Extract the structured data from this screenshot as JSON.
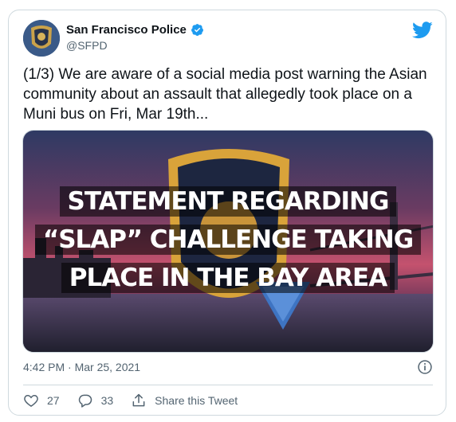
{
  "author": {
    "name": "San Francisco Police",
    "handle": "@SFPD"
  },
  "tweet": {
    "text": "(1/3) We are aware of a social media post warning the Asian community about an assault that allegedly took place on a Muni bus on Fri, Mar 19th...",
    "timestamp": "4:42 PM · Mar 25, 2021"
  },
  "media": {
    "headline_lines": [
      "STATEMENT REGARDING",
      "“SLAP” CHALLENGE TAKING",
      "PLACE IN THE BAY AREA"
    ]
  },
  "actions": {
    "likes": "27",
    "replies": "33",
    "share_label": "Share this Tweet"
  },
  "icons": {
    "brand": "twitter-bird-icon",
    "verified": "verified-badge-icon",
    "info": "info-icon",
    "like": "heart-icon",
    "reply": "reply-icon",
    "share": "share-icon"
  },
  "colors": {
    "brand_blue": "#1d9bf0",
    "secondary_text": "#536471",
    "border": "#cfd9de"
  }
}
